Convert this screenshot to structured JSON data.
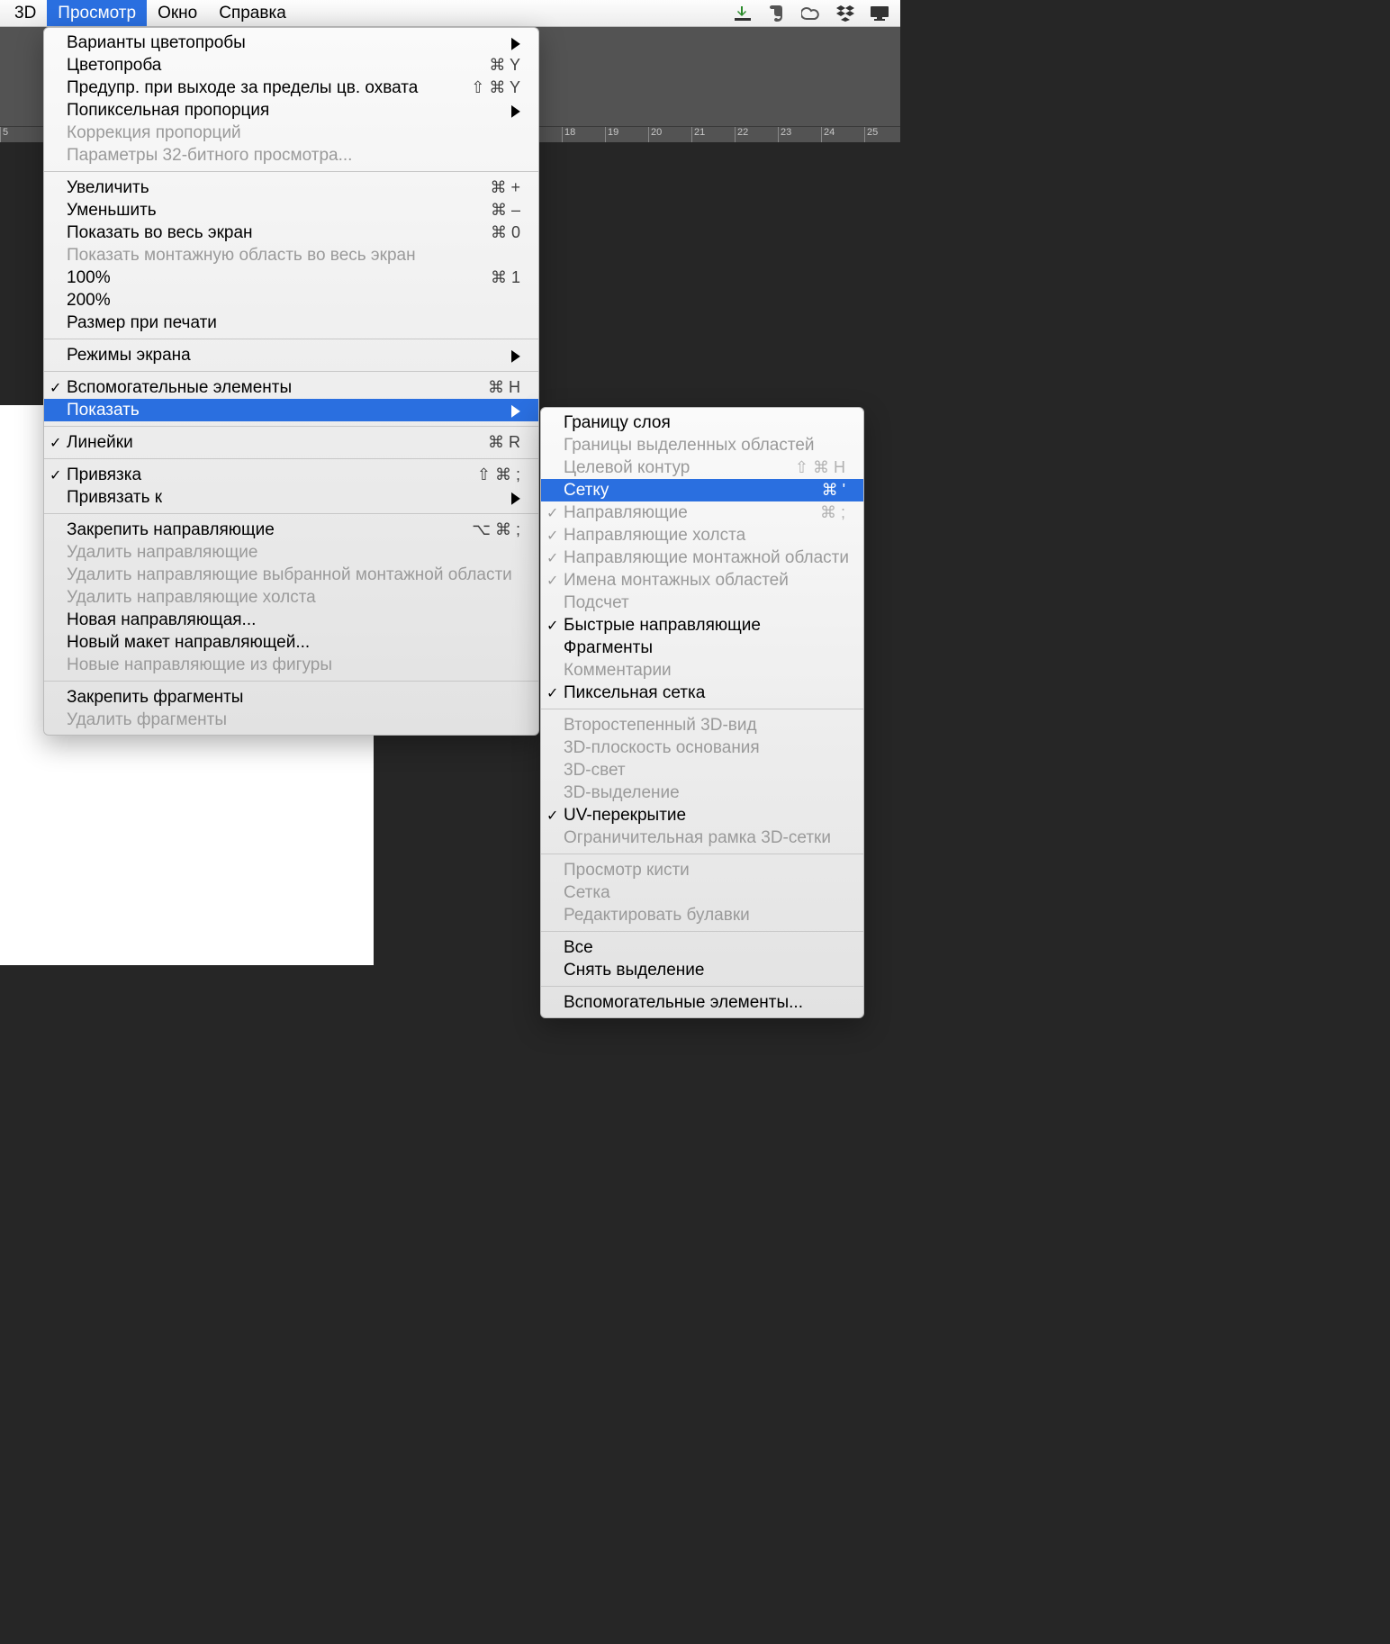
{
  "menubar": {
    "items": [
      "3D",
      "Просмотр",
      "Окно",
      "Справка"
    ],
    "activeIndex": 1
  },
  "ruler": {
    "start": 5,
    "end": 27
  },
  "mainMenu": [
    {
      "t": "item",
      "label": "Варианты цветопробы",
      "arrow": true
    },
    {
      "t": "item",
      "label": "Цветопроба",
      "sc": "⌘ Y"
    },
    {
      "t": "item",
      "label": "Предупр. при выходе за пределы цв. охвата",
      "sc": "⇧ ⌘ Y"
    },
    {
      "t": "item",
      "label": "Попиксельная пропорция",
      "arrow": true
    },
    {
      "t": "item",
      "label": "Коррекция пропорций",
      "disabled": true
    },
    {
      "t": "item",
      "label": "Параметры 32-битного просмотра...",
      "disabled": true
    },
    {
      "t": "sep"
    },
    {
      "t": "item",
      "label": "Увеличить",
      "sc": "⌘ +"
    },
    {
      "t": "item",
      "label": "Уменьшить",
      "sc": "⌘ –"
    },
    {
      "t": "item",
      "label": "Показать во весь экран",
      "sc": "⌘ 0"
    },
    {
      "t": "item",
      "label": "Показать монтажную область во весь экран",
      "disabled": true
    },
    {
      "t": "item",
      "label": "100%",
      "sc": "⌘ 1"
    },
    {
      "t": "item",
      "label": "200%"
    },
    {
      "t": "item",
      "label": "Размер при печати"
    },
    {
      "t": "sep"
    },
    {
      "t": "item",
      "label": "Режимы экрана",
      "arrow": true
    },
    {
      "t": "sep"
    },
    {
      "t": "item",
      "label": "Вспомогательные элементы",
      "sc": "⌘ H",
      "check": true
    },
    {
      "t": "item",
      "label": "Показать",
      "arrow": true,
      "highlight": true
    },
    {
      "t": "sep"
    },
    {
      "t": "item",
      "label": "Линейки",
      "sc": "⌘ R",
      "check": true
    },
    {
      "t": "sep"
    },
    {
      "t": "item",
      "label": "Привязка",
      "sc": "⇧ ⌘ ;",
      "check": true
    },
    {
      "t": "item",
      "label": "Привязать к",
      "arrow": true
    },
    {
      "t": "sep"
    },
    {
      "t": "item",
      "label": "Закрепить направляющие",
      "sc": "⌥ ⌘ ;"
    },
    {
      "t": "item",
      "label": "Удалить направляющие",
      "disabled": true
    },
    {
      "t": "item",
      "label": "Удалить направляющие выбранной монтажной области",
      "disabled": true
    },
    {
      "t": "item",
      "label": "Удалить направляющие холста",
      "disabled": true
    },
    {
      "t": "item",
      "label": "Новая направляющая..."
    },
    {
      "t": "item",
      "label": "Новый макет направляющей..."
    },
    {
      "t": "item",
      "label": "Новые направляющие из фигуры",
      "disabled": true
    },
    {
      "t": "sep"
    },
    {
      "t": "item",
      "label": "Закрепить фрагменты"
    },
    {
      "t": "item",
      "label": "Удалить фрагменты",
      "disabled": true
    }
  ],
  "subMenu": [
    {
      "t": "item",
      "label": "Границу слоя"
    },
    {
      "t": "item",
      "label": "Границы выделенных областей",
      "disabled": true
    },
    {
      "t": "item",
      "label": "Целевой контур",
      "sc": "⇧ ⌘ H",
      "disabled": true
    },
    {
      "t": "item",
      "label": "Сетку",
      "sc": "⌘ '",
      "highlight": true
    },
    {
      "t": "item",
      "label": "Направляющие",
      "sc": "⌘ ;",
      "disabled": true,
      "check": true
    },
    {
      "t": "item",
      "label": "Направляющие холста",
      "disabled": true,
      "check": true
    },
    {
      "t": "item",
      "label": "Направляющие монтажной области",
      "disabled": true,
      "check": true
    },
    {
      "t": "item",
      "label": "Имена монтажных областей",
      "disabled": true,
      "check": true
    },
    {
      "t": "item",
      "label": "Подсчет",
      "disabled": true
    },
    {
      "t": "item",
      "label": "Быстрые направляющие",
      "check": true
    },
    {
      "t": "item",
      "label": "Фрагменты"
    },
    {
      "t": "item",
      "label": "Комментарии",
      "disabled": true
    },
    {
      "t": "item",
      "label": "Пиксельная сетка",
      "check": true
    },
    {
      "t": "sep"
    },
    {
      "t": "item",
      "label": "Второстепенный 3D-вид",
      "disabled": true
    },
    {
      "t": "item",
      "label": "3D-плоскость основания",
      "disabled": true
    },
    {
      "t": "item",
      "label": "3D-свет",
      "disabled": true
    },
    {
      "t": "item",
      "label": "3D-выделение",
      "disabled": true
    },
    {
      "t": "item",
      "label": "UV-перекрытие",
      "check": true
    },
    {
      "t": "item",
      "label": "Ограничительная рамка 3D-сетки",
      "disabled": true
    },
    {
      "t": "sep"
    },
    {
      "t": "item",
      "label": "Просмотр кисти",
      "disabled": true
    },
    {
      "t": "item",
      "label": "Сетка",
      "disabled": true
    },
    {
      "t": "item",
      "label": "Редактировать булавки",
      "disabled": true
    },
    {
      "t": "sep"
    },
    {
      "t": "item",
      "label": "Все"
    },
    {
      "t": "item",
      "label": "Снять выделение"
    },
    {
      "t": "sep"
    },
    {
      "t": "item",
      "label": "Вспомогательные элементы..."
    }
  ],
  "statusIcons": [
    "download",
    "evernote",
    "cc",
    "dropbox",
    "display"
  ]
}
